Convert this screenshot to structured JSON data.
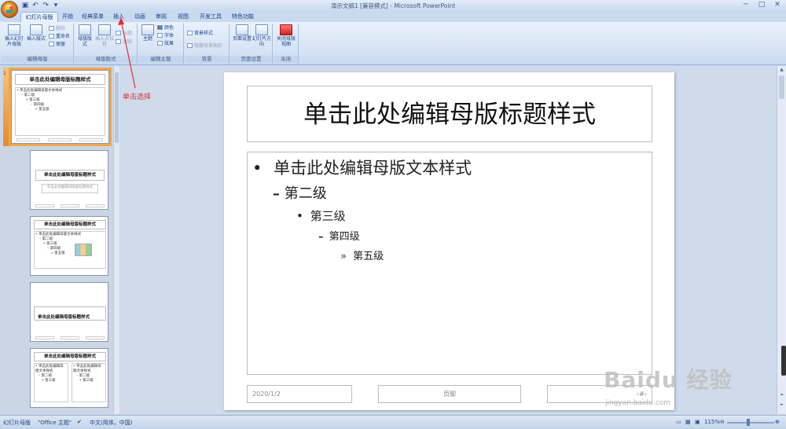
{
  "window": {
    "title": "演示文稿1 [兼容模式] - Microsoft PowerPoint"
  },
  "tabs": [
    "幻灯片母版",
    "开始",
    "经典菜单",
    "插入",
    "动画",
    "审阅",
    "视图",
    "开发工具",
    "特色功能"
  ],
  "ribbon": {
    "edit_master": {
      "label": "编辑母版",
      "insert_master": "插入幻灯片母版",
      "insert_layout": "插入版式",
      "delete": "删除",
      "rename": "重命名",
      "preserve": "保留"
    },
    "master_layout": {
      "label": "母版版式",
      "master_layout_btn": "母版版式",
      "insert_placeholder": "插入占位符",
      "title": "标题",
      "footers": "页脚"
    },
    "edit_theme": {
      "label": "编辑主题",
      "themes": "主题",
      "colors": "颜色",
      "fonts": "字体",
      "effects": "效果"
    },
    "background": {
      "label": "背景",
      "bg_styles": "背景样式",
      "hide_bg": "隐藏背景图形"
    },
    "page_setup": {
      "label": "页面设置",
      "page_setup_btn": "页面设置",
      "orientation": "幻灯片方向"
    },
    "close": {
      "label": "关闭",
      "close_btn": "关闭母版视图"
    }
  },
  "annotation": "单击选择",
  "slide": {
    "title": "单击此处编辑母版标题样式",
    "levels": [
      "单击此处编辑母版文本样式",
      "第二级",
      "第三级",
      "第四级",
      "第五级"
    ],
    "bullets": [
      "•",
      "–",
      "•",
      "–",
      "»"
    ],
    "date": "2020/1/2",
    "footer": "页脚",
    "page_num": "‹#›"
  },
  "thumbnails": {
    "num1": "1",
    "t1_title": "单击此处编辑母版标题样式",
    "t1_body": [
      "• 单击此处编辑母版文本样式",
      "– 第二级",
      "• 第三级",
      "– 第四级",
      "» 第五级"
    ],
    "t2_title": "单击此处编辑母版标题样式",
    "t2_sub": "单击此处编辑母版副标题样式",
    "t3_title": "单击此处编辑母版标题样式",
    "t3_body": [
      "• 单击此处编辑母版文本样式",
      "– 第二级",
      "• 第三级",
      "– 第四级",
      "» 第五级"
    ],
    "t4_title": "单击此处编辑母版标题样式",
    "t5_title": "单击此处编辑母版标题样式",
    "t5_col1": [
      "• 单击此处编辑母版文本样式",
      "– 第二级",
      "• 第三级"
    ],
    "t5_col2": [
      "• 单击此处编辑母版文本样式",
      "– 第二级",
      "• 第三级"
    ]
  },
  "statusbar": {
    "view": "幻灯片母版",
    "theme": "\"Office 主题\"",
    "lang": "中文(简体，中国)",
    "zoom": "115%"
  },
  "watermark": {
    "main": "Baidu 经验",
    "sub": "jingyan.baidu.com"
  },
  "colors": {
    "accent": "#15428b",
    "annotation": "#e03030",
    "selection": "#f1a74a"
  }
}
